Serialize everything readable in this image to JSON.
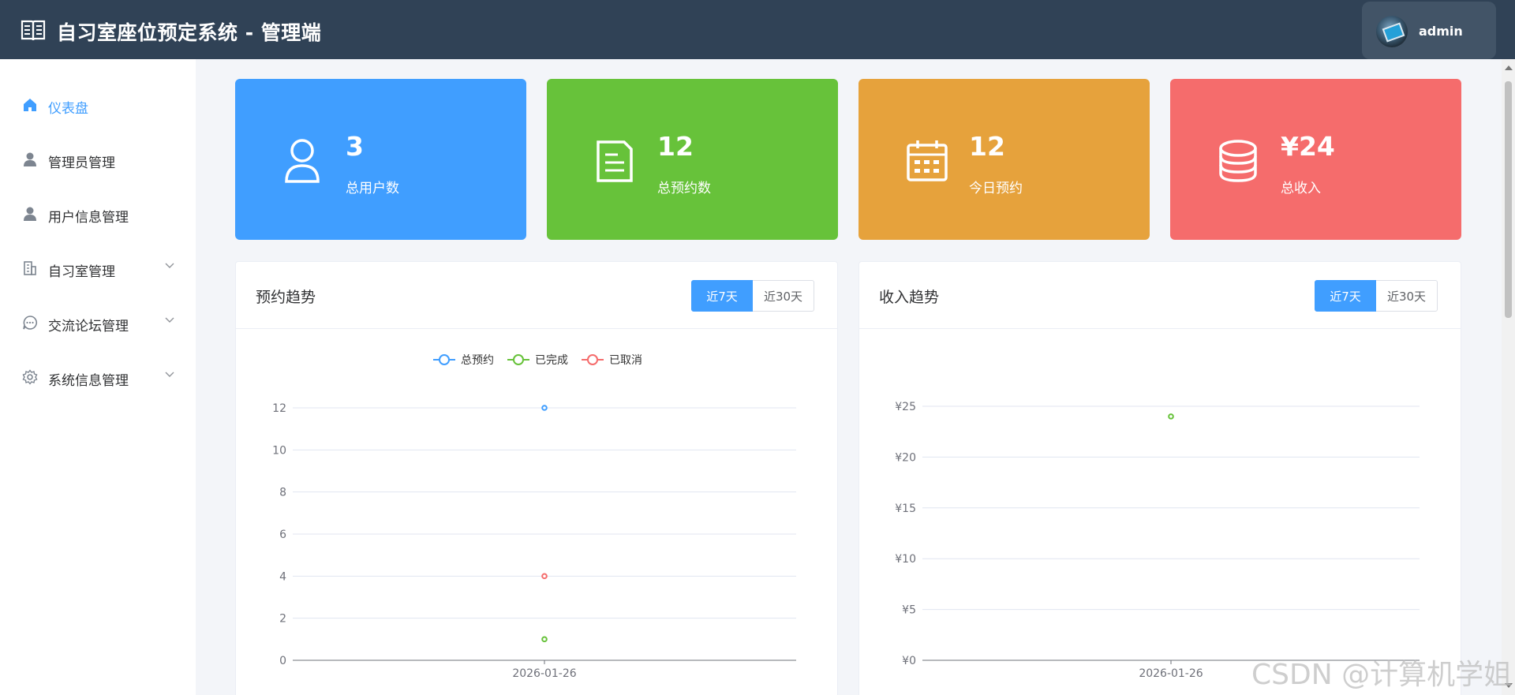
{
  "header": {
    "title": "自习室座位预定系统 - 管理端",
    "user": "admin"
  },
  "sidebar": {
    "items": [
      {
        "label": "仪表盘",
        "icon": "home-icon",
        "active": true
      },
      {
        "label": "管理员管理",
        "icon": "user-icon"
      },
      {
        "label": "用户信息管理",
        "icon": "user-icon"
      },
      {
        "label": "自习室管理",
        "icon": "building-icon",
        "expandable": true
      },
      {
        "label": "交流论坛管理",
        "icon": "chat-icon",
        "expandable": true
      },
      {
        "label": "系统信息管理",
        "icon": "gear-icon",
        "expandable": true
      }
    ]
  },
  "stats": [
    {
      "value": "3",
      "label": "总用户数",
      "color": "#409eff",
      "icon": "user-icon"
    },
    {
      "value": "12",
      "label": "总预约数",
      "color": "#67c23a",
      "icon": "document-icon"
    },
    {
      "value": "12",
      "label": "今日预约",
      "color": "#e6a23c",
      "icon": "calendar-icon"
    },
    {
      "value": "¥24",
      "label": "总收入",
      "color": "#f56c6c",
      "icon": "coins-icon"
    }
  ],
  "panels": {
    "booking": {
      "title": "预约趋势",
      "tabs": [
        "近7天",
        "近30天"
      ],
      "active_tab": "近7天"
    },
    "income": {
      "title": "收入趋势",
      "tabs": [
        "近7天",
        "近30天"
      ],
      "active_tab": "近7天"
    }
  },
  "chart_data": [
    {
      "type": "line",
      "categories": [
        "2026-01-26"
      ],
      "series": [
        {
          "name": "总预约",
          "values": [
            12
          ],
          "color": "#409eff"
        },
        {
          "name": "已完成",
          "values": [
            1
          ],
          "color": "#67c23a"
        },
        {
          "name": "已取消",
          "values": [
            4
          ],
          "color": "#f56c6c"
        }
      ],
      "yticks": [
        "0",
        "2",
        "4",
        "6",
        "8",
        "10",
        "12"
      ],
      "ylim": [
        0,
        12
      ],
      "grid": true,
      "legend": "top-center"
    },
    {
      "type": "line",
      "categories": [
        "2026-01-26"
      ],
      "series": [
        {
          "values": [
            24
          ],
          "color": "#67c23a"
        }
      ],
      "yticks": [
        "¥0",
        "¥5",
        "¥10",
        "¥15",
        "¥20",
        "¥25"
      ],
      "ylim": [
        0,
        25
      ],
      "grid": true
    }
  ],
  "watermark": "CSDN @计算机学姐"
}
